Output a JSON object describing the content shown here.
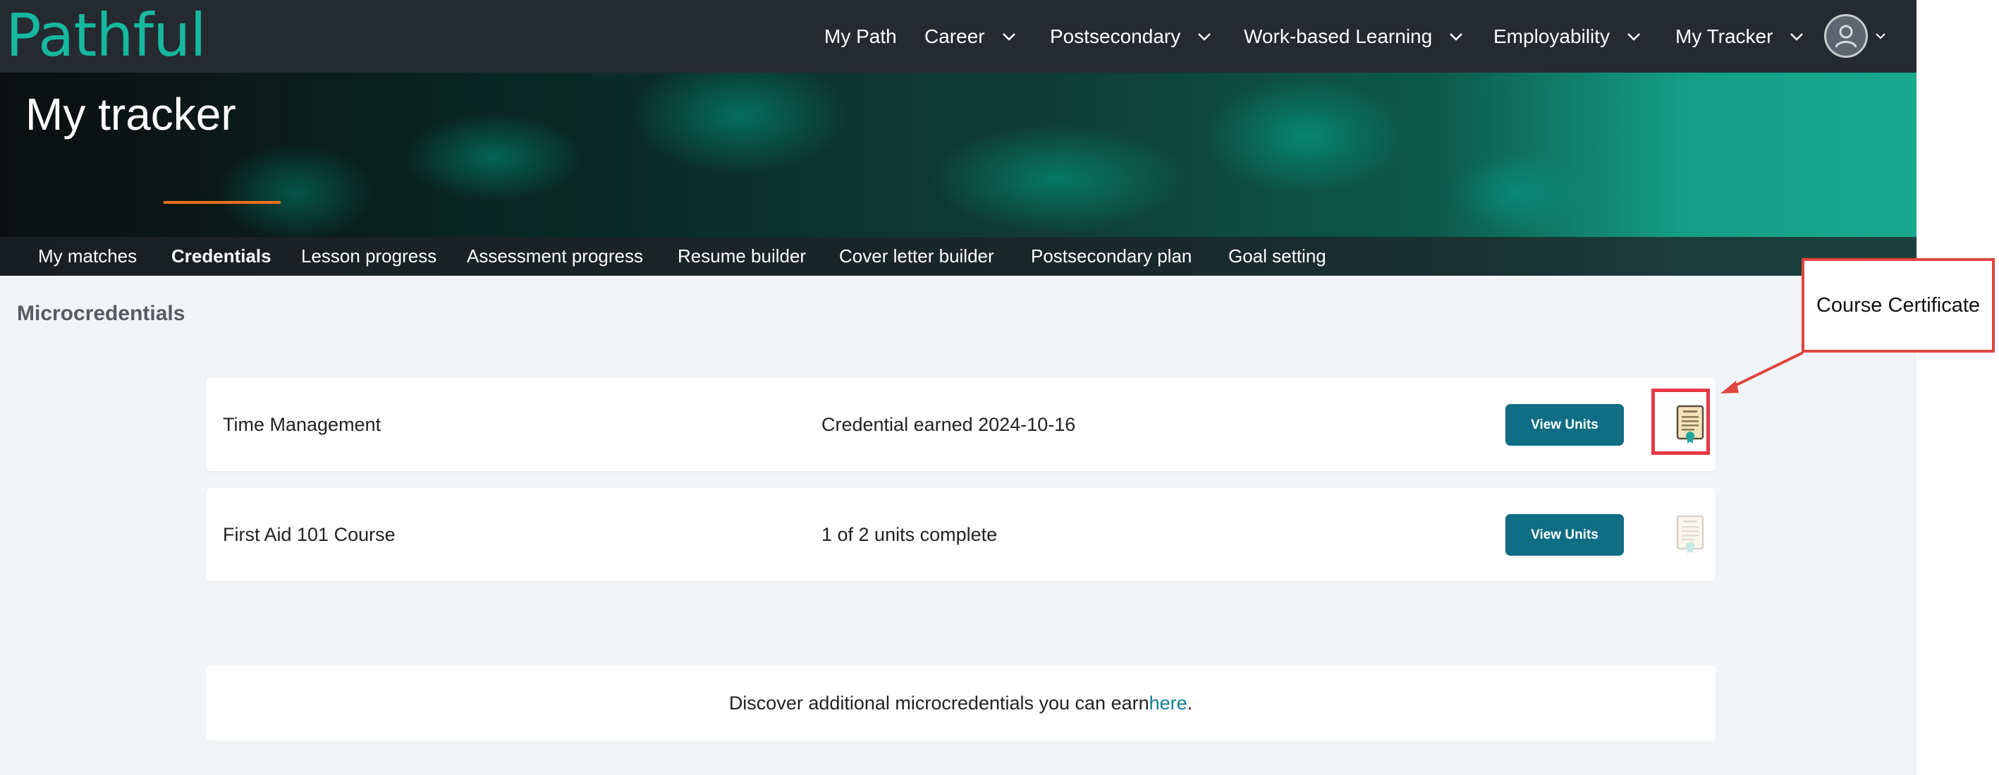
{
  "brand": {
    "logo_text": "Pathful"
  },
  "nav": {
    "items": [
      {
        "label": "My Path",
        "has_dropdown": false
      },
      {
        "label": "Career",
        "has_dropdown": true
      },
      {
        "label": "Postsecondary",
        "has_dropdown": true
      },
      {
        "label": "Work-based Learning",
        "has_dropdown": true
      },
      {
        "label": "Employability",
        "has_dropdown": true
      },
      {
        "label": "My Tracker",
        "has_dropdown": true
      }
    ]
  },
  "banner": {
    "title": "My tracker"
  },
  "tabs": [
    {
      "label": "My matches",
      "active": false
    },
    {
      "label": "Credentials",
      "active": true
    },
    {
      "label": "Lesson progress",
      "active": false
    },
    {
      "label": "Assessment progress",
      "active": false
    },
    {
      "label": "Resume builder",
      "active": false
    },
    {
      "label": "Cover letter builder",
      "active": false
    },
    {
      "label": "Postsecondary plan",
      "active": false
    },
    {
      "label": "Goal setting",
      "active": false
    }
  ],
  "section": {
    "title": "Microcredentials"
  },
  "credentials": [
    {
      "name": "Time Management",
      "status": "Credential earned 2024-10-16",
      "button_label": "View Units",
      "certificate_available": true
    },
    {
      "name": "First Aid 101 Course",
      "status": "1 of 2 units complete",
      "button_label": "View Units",
      "certificate_available": false
    }
  ],
  "discover": {
    "text": "Discover additional microcredentials you can earn ",
    "link_text": "here",
    "suffix": "."
  },
  "annotation": {
    "label": "Course Certificate"
  },
  "colors": {
    "nav_bg": "#252a31",
    "accent_teal": "#17b8a0",
    "button": "#0f6e84",
    "active_tab_underline": "#e9711c",
    "annotation_red": "#e0453e",
    "link": "#0f7e97"
  }
}
